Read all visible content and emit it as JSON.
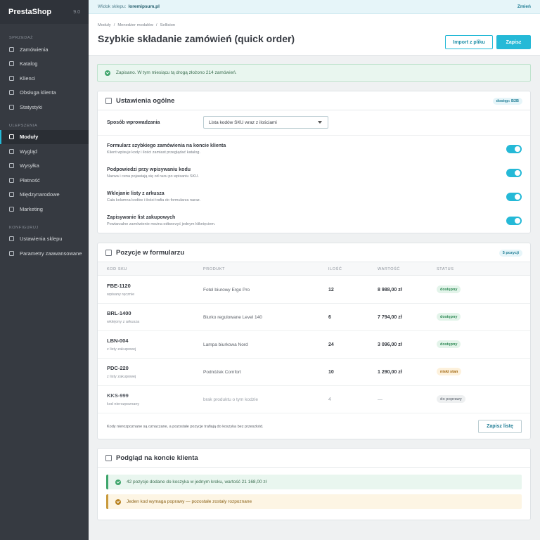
{
  "sidebar": {
    "brand": "PrestaShop",
    "version": "9.0",
    "sections": [
      {
        "label": "SPRZEDAŻ",
        "items": [
          "Zamówienia",
          "Katalog",
          "Klienci",
          "Obsługa klienta",
          "Statystyki"
        ]
      },
      {
        "label": "ULEPSZENIA",
        "items": [
          "Moduły",
          "Wygląd",
          "Wysyłka",
          "Płatność",
          "Międzynarodowe",
          "Marketing"
        ]
      },
      {
        "label": "KONFIGURUJ",
        "items": [
          "Ustawienia sklepu",
          "Parametry zaawansowane"
        ]
      }
    ],
    "active_item": "Moduły"
  },
  "topbar": {
    "store_label": "Widok sklepu:",
    "store_domain": "loremipsum.pl",
    "change_label": "Zmień"
  },
  "header": {
    "breadcrumbs": [
      "Moduły",
      "Menedżer modułów",
      "Sellision"
    ],
    "title": "Szybkie składanie zamówień (quick order)",
    "import_label": "Import z pliku",
    "save_label": "Zapisz"
  },
  "alert": {
    "text": "Zapisano. W tym miesiącu tą drogą złożono 214 zamówień."
  },
  "general": {
    "title": "Ustawienia ogólne",
    "badge": "dostęp: B2B",
    "input_method_label": "Sposób wprowadzania",
    "input_method_value": "Lista kodów SKU wraz z ilościami",
    "options": [
      {
        "title": "Formularz szybkiego zamówienia na koncie klienta",
        "desc": "Klient wpisuje kody i ilości zamiast przeglądać katalog.",
        "on": true
      },
      {
        "title": "Podpowiedzi przy wpisywaniu kodu",
        "desc": "Nazwa i cena pojawiają się od razu po wpisaniu SKU.",
        "on": true
      },
      {
        "title": "Wklejanie listy z arkusza",
        "desc": "Cała kolumna kodów i ilości trafia do formularza naraz.",
        "on": true
      },
      {
        "title": "Zapisywanie list zakupowych",
        "desc": "Powtarzalne zamówienie można odtworzyć jednym kliknięciem.",
        "on": true
      }
    ]
  },
  "positions": {
    "title": "Pozycje w formularzu",
    "badge": "5 pozycji",
    "headers": {
      "sku": "KOD SKU",
      "product": "PRODUKT",
      "qty": "ILOŚĆ",
      "value": "WARTOŚĆ",
      "status": "STATUS"
    },
    "rows": [
      {
        "sku": "FBE-1120",
        "source": "wpisany ręcznie",
        "product": "Fotel biurowy Ergo Pro",
        "qty": "12",
        "value": "8 988,00 zł",
        "status": "dostępny",
        "kind": "ok"
      },
      {
        "sku": "BRL-1400",
        "source": "wklejony z arkusza",
        "product": "Biurko regulowane Level 140",
        "qty": "6",
        "value": "7 794,00 zł",
        "status": "dostępny",
        "kind": "ok"
      },
      {
        "sku": "LBN-004",
        "source": "z listy zakupowej",
        "product": "Lampa biurkowa Nord",
        "qty": "24",
        "value": "3 096,00 zł",
        "status": "dostępny",
        "kind": "ok"
      },
      {
        "sku": "PDC-220",
        "source": "z listy zakupowej",
        "product": "Podnóżek Comfort",
        "qty": "10",
        "value": "1 290,00 zł",
        "status": "niski stan",
        "kind": "low"
      },
      {
        "sku": "KKS-999",
        "source": "kod nierozpoznany",
        "product": "brak produktu o tym kodzie",
        "qty": "4",
        "value": "—",
        "status": "do poprawy",
        "kind": "fix"
      }
    ],
    "footer_note": "Kody nierozpoznane są oznaczane, a pozostałe pozycje trafiają do koszyka bez przeszkód.",
    "save_list_label": "Zapisz listę"
  },
  "preview": {
    "title": "Podgląd na koncie klienta",
    "success": "42 pozycje dodane do koszyka w jednym kroku, wartość 21 168,00 zł",
    "warning": "Jeden kod wymaga poprawy — pozostałe zostały rozpoznane"
  },
  "colors": {
    "accent": "#25b9d7",
    "sidebar": "#363a41",
    "success": "#3ea56b",
    "warning": "#c89a3c"
  }
}
